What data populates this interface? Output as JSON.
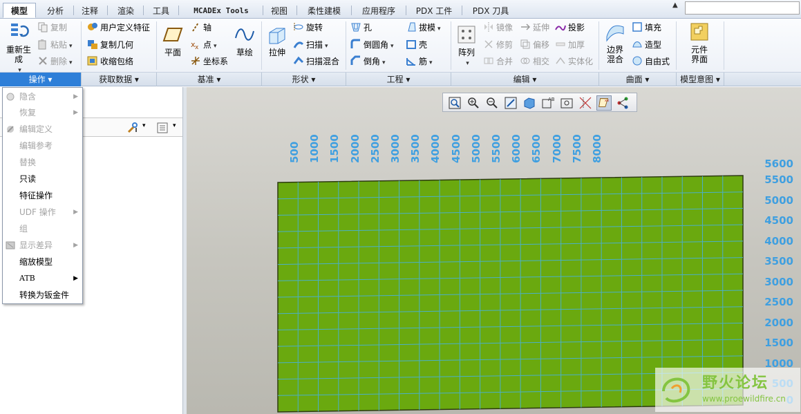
{
  "tabs": [
    {
      "label": "模型",
      "active": true
    },
    {
      "label": "分析"
    },
    {
      "label": "注释"
    },
    {
      "label": "渲染"
    },
    {
      "label": "工具"
    },
    {
      "label": "MCADEx Tools"
    },
    {
      "label": "视图"
    },
    {
      "label": "柔性建模"
    },
    {
      "label": "应用程序"
    },
    {
      "label": "PDX 工件"
    },
    {
      "label": "PDX 刀具"
    }
  ],
  "ribbon": {
    "operations": {
      "regen": "重新生成",
      "copy": "复制",
      "paste": "粘贴",
      "delete": "删除"
    },
    "get_data": {
      "udf": "用户定义特征",
      "copy_geom": "复制几何",
      "shrinkwrap": "收缩包络"
    },
    "datum": {
      "plane": "平面",
      "axis": "轴",
      "point": "点",
      "csys": "坐标系",
      "sketch": "草绘"
    },
    "shapes": {
      "extrude": "拉伸",
      "revolve": "旋转",
      "sweep": "扫描",
      "swept_blend": "扫描混合"
    },
    "engineering": {
      "hole": "孔",
      "round": "倒圆角",
      "chamfer": "倒角",
      "draft": "拔模",
      "shell": "壳",
      "rib": "筋"
    },
    "editing": {
      "pattern": "阵列",
      "mirror": "镜像",
      "extend": "延伸",
      "project": "投影",
      "trim": "修剪",
      "offset": "偏移",
      "thicken": "加厚",
      "merge": "合并",
      "intersect": "相交",
      "solidify": "实体化"
    },
    "surfaces": {
      "boundary": "边界混合",
      "fill": "填充",
      "style": "造型",
      "freestyle": "自由式"
    },
    "intent": {
      "component_interface": "元件界面"
    }
  },
  "groups": {
    "operations": "操作",
    "get_data": "获取数据",
    "datum": "基准",
    "shapes": "形状",
    "engineering": "工程",
    "editing": "编辑",
    "surfaces": "曲面",
    "intent": "模型意图"
  },
  "menu": {
    "items": [
      {
        "label": "隐含",
        "disabled": true,
        "submenu": true
      },
      {
        "label": "恢复",
        "disabled": true,
        "submenu": true
      },
      {
        "label": "编辑定义",
        "disabled": true
      },
      {
        "label": "编辑参考",
        "disabled": true
      },
      {
        "label": "替换",
        "disabled": true
      },
      {
        "label": "只读"
      },
      {
        "label": "特征操作"
      },
      {
        "label": "UDF 操作",
        "disabled": true,
        "submenu": true
      },
      {
        "label": "组",
        "disabled": true
      },
      {
        "label": "显示差异",
        "disabled": true,
        "submenu": true
      },
      {
        "label": "缩放模型"
      },
      {
        "label": "ATB",
        "submenu": true
      },
      {
        "label": "转换为钣金件"
      }
    ]
  },
  "viewport": {
    "x_labels": [
      "500",
      "1000",
      "1500",
      "2000",
      "2500",
      "3000",
      "3500",
      "4000",
      "4500",
      "5000",
      "5500",
      "6000",
      "6500",
      "7000",
      "7500",
      "8000"
    ],
    "y_labels": [
      "5600",
      "5500",
      "5000",
      "4500",
      "4000",
      "3500",
      "3000",
      "2500",
      "2000",
      "1500",
      "1000",
      "500",
      "0"
    ],
    "plane_color": "#6aa90f",
    "grid_color": "#4ab0c8"
  },
  "watermark": {
    "title": "野火论坛",
    "url": "www.proewildfire.cn"
  }
}
